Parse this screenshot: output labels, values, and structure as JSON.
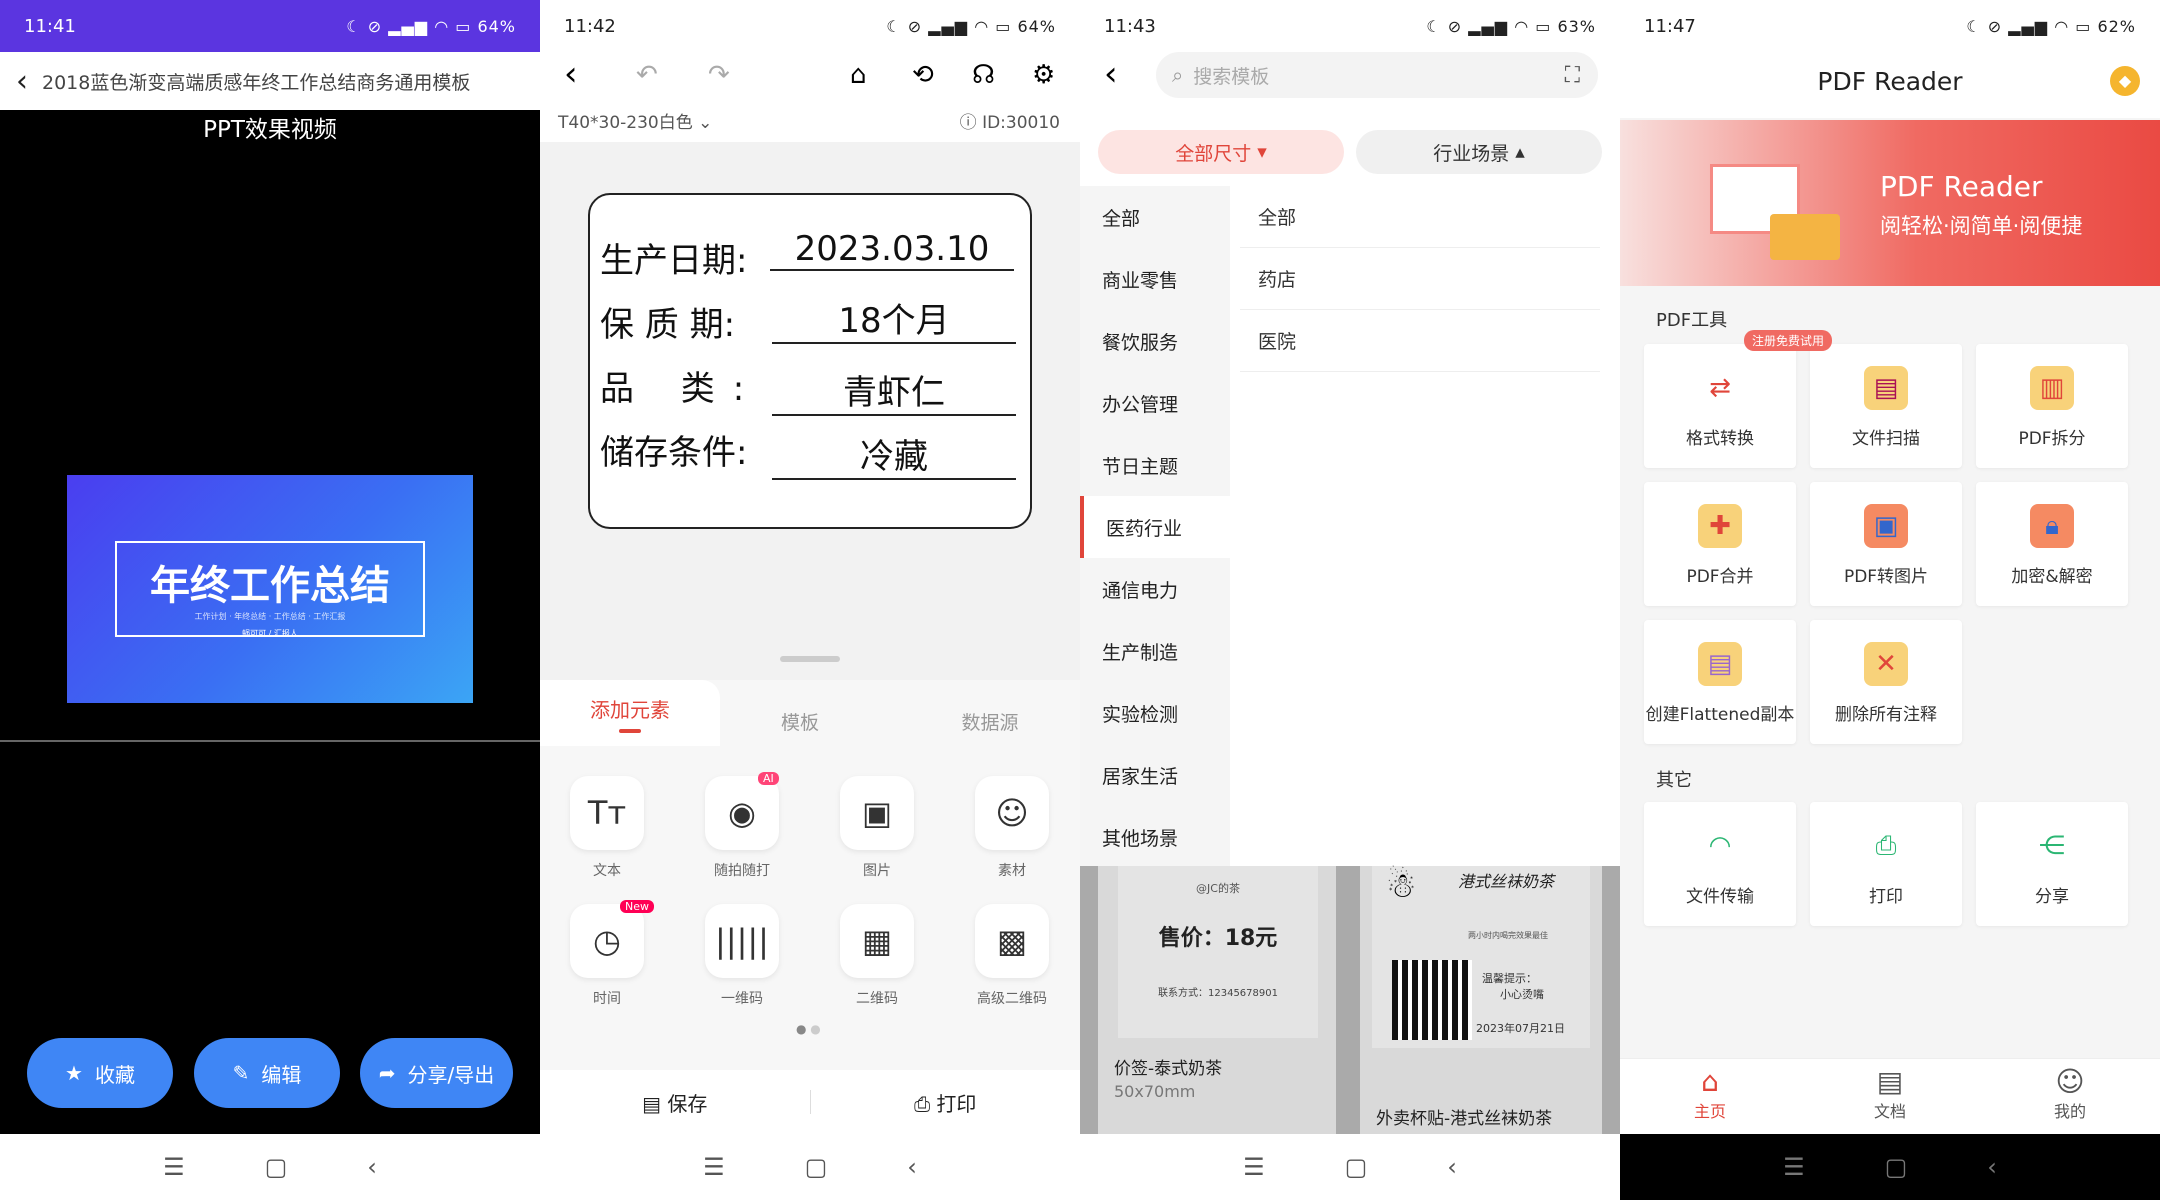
{
  "panel1": {
    "status_time": "11:41",
    "status_right": "64%",
    "title": "2018蓝色渐变高端质感年终工作总结商务通用模板",
    "video_label": "PPT效果视频",
    "slide_title": "年终工作总结",
    "slide_sub": "工作计划 · 年终总结 · 工作总结 · 工作汇报",
    "slide_author": "蜗可可 / 汇报人",
    "buttons": [
      "收藏",
      "编辑",
      "分享/导出"
    ]
  },
  "panel2": {
    "status_time": "11:42",
    "status_right": "64%",
    "spec": "T40*30-230白色",
    "id": "ID:30010",
    "rows": [
      {
        "k": "生产日期:",
        "v": "2023.03.10"
      },
      {
        "k": "保 质 期:",
        "v": "18个月"
      },
      {
        "k": "品 类:",
        "v": "青虾仁"
      },
      {
        "k": "储存条件:",
        "v": "冷藏"
      }
    ],
    "tabs": [
      "添加元素",
      "模板",
      "数据源"
    ],
    "tools": [
      "文本",
      "随拍随打",
      "图片",
      "素材",
      "时间",
      "一维码",
      "二维码",
      "高级二维码"
    ],
    "badge_ai": "AI",
    "badge_new": "New",
    "save": "保存",
    "print": "打印"
  },
  "panel3": {
    "status_time": "11:43",
    "status_right": "63%",
    "search_placeholder": "搜索模板",
    "filter_size": "全部尺寸",
    "filter_scene": "行业场景",
    "categories": [
      "全部",
      "商业零售",
      "餐饮服务",
      "办公管理",
      "节日主题",
      "医药行业",
      "通信电力",
      "生产制造",
      "实验检测",
      "居家生活",
      "其他场景"
    ],
    "subs": [
      "全部",
      "药店",
      "医院"
    ],
    "card1_price": "售价：18元",
    "card1_shop": "@JC的茶",
    "card1_contact": "联系方式：12345678901",
    "card1_title": "价签-泰式奶茶",
    "card1_size": "50x70mm",
    "card2_name": "港式丝袜奶茶",
    "card2_tip": "温馨提示：",
    "card2_tip2": "小心烫嘴",
    "card2_date": "2023年07月21日",
    "card2_note": "两小时内喝完效果最佳",
    "card2_title": "外卖杯贴-港式丝袜奶茶"
  },
  "panel4": {
    "status_time": "11:47",
    "status_right": "62%",
    "title": "PDF Reader",
    "banner_title": "PDF Reader",
    "banner_sub": "阅轻松·阅简单·阅便捷",
    "section1": "PDF工具",
    "trial_badge": "注册免费试用",
    "tools": [
      "格式转换",
      "文件扫描",
      "PDF拆分",
      "PDF合并",
      "PDF转图片",
      "加密&解密",
      "创建Flattened副本",
      "删除所有注释"
    ],
    "section2": "其它",
    "others": [
      "文件传输",
      "打印",
      "分享"
    ],
    "tabs": [
      "主页",
      "文档",
      "我的"
    ]
  }
}
